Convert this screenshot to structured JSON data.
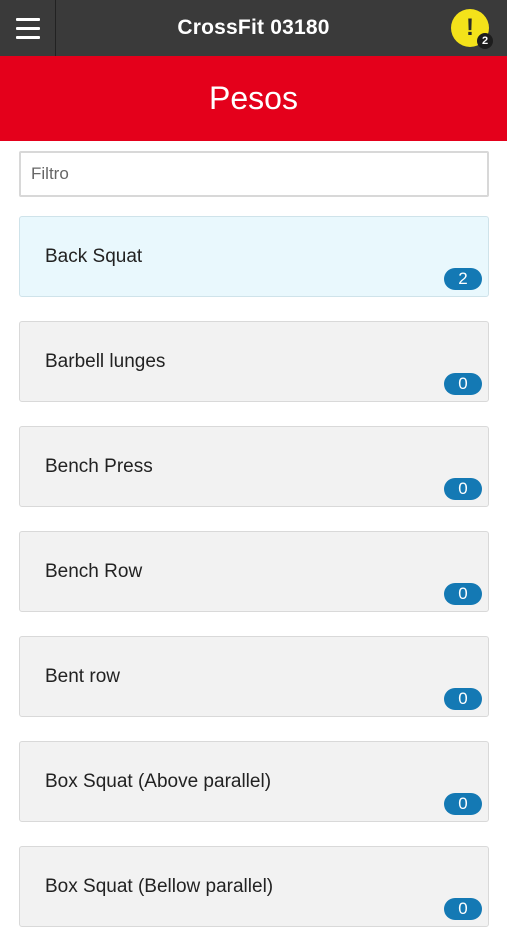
{
  "app": {
    "title": "CrossFit 03180",
    "alert_icon": "!",
    "alert_count": "2"
  },
  "page": {
    "title": "Pesos"
  },
  "filter": {
    "placeholder": "Filtro",
    "value": ""
  },
  "exercises": [
    {
      "name": "Back Squat",
      "count": "2",
      "active": true
    },
    {
      "name": "Barbell lunges",
      "count": "0",
      "active": false
    },
    {
      "name": "Bench Press",
      "count": "0",
      "active": false
    },
    {
      "name": "Bench Row",
      "count": "0",
      "active": false
    },
    {
      "name": "Bent row",
      "count": "0",
      "active": false
    },
    {
      "name": "Box Squat (Above parallel)",
      "count": "0",
      "active": false
    },
    {
      "name": "Box Squat (Bellow parallel)",
      "count": "0",
      "active": false
    }
  ],
  "colors": {
    "topbar": "#3a3a3a",
    "header": "#e4001b",
    "alert": "#f4e21a",
    "badge": "#1479b4",
    "active_item": "#e9f8fd"
  }
}
